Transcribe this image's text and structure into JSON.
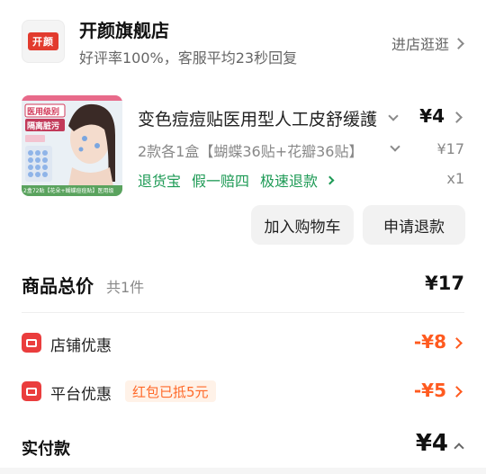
{
  "store": {
    "logo_text": "开颜",
    "name": "开颜旗舰店",
    "rating": "好评率100%，客服平均23秒回复",
    "enter_label": "进店逛逛"
  },
  "product": {
    "thumb_text_top": "医用级别",
    "thumb_text_mid": "隔离脏污",
    "thumb_text_bottom": "2盒72贴【花朵+蝴蝶痘痘贴】医用级",
    "title": "变色痘痘贴医用型人工皮舒缓護",
    "price": "¥4",
    "variant": "2款各1盒【蝴蝶36贴+花瓣36贴】",
    "original_price": "¥17",
    "services": [
      "退货宝",
      "假一赔四",
      "极速退款"
    ],
    "quantity": "x1"
  },
  "actions": {
    "add_to_cart": "加入购物车",
    "request_refund": "申请退款"
  },
  "summary": {
    "total_label": "商品总价",
    "total_count": "共1件",
    "total_value": "¥17",
    "store_discount_label": "店铺优惠",
    "store_discount_value": "-¥8",
    "platform_discount_label": "平台优惠",
    "platform_discount_tag": "红包已抵5元",
    "platform_discount_value": "-¥5",
    "paid_label": "实付款",
    "paid_value": "¥4"
  },
  "colors": {
    "accent_orange": "#ff5a1f",
    "service_green": "#1d9a55",
    "promo_red": "#ea3d3d"
  }
}
